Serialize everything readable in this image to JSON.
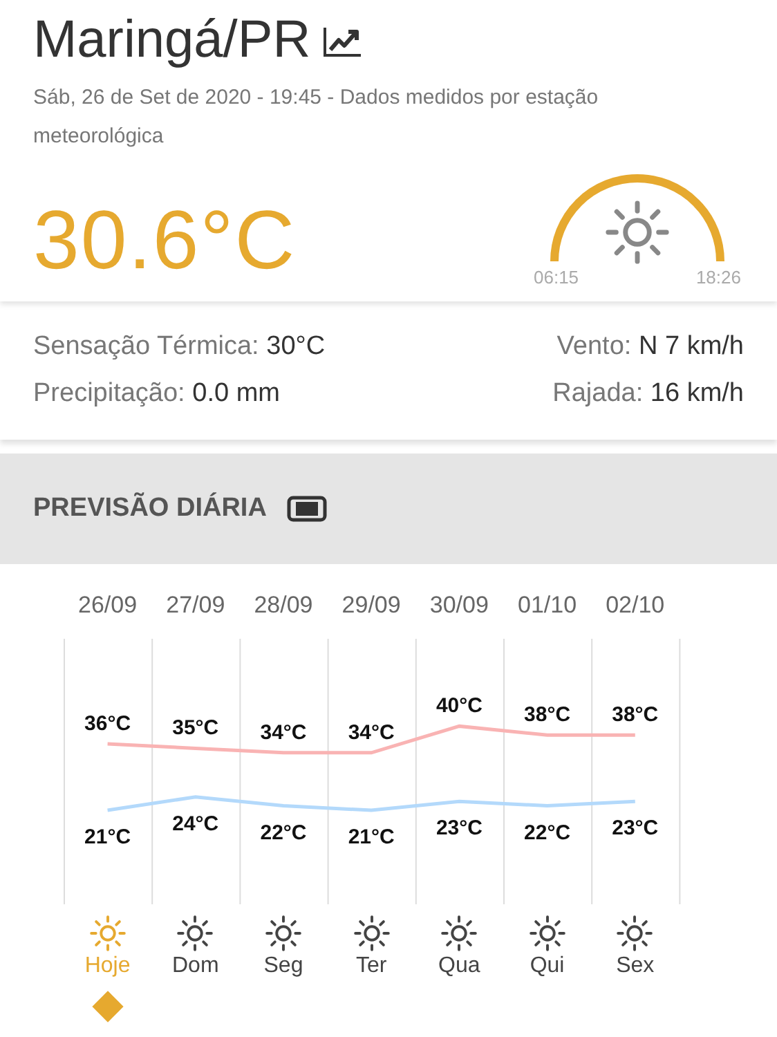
{
  "location": {
    "title": "Maringá/PR",
    "subtitle": "Sáb, 26 de Set de 2020 - 19:45 - Dados medidos por estação meteorológica"
  },
  "current": {
    "temperature": "30.6°C",
    "sunrise": "06:15",
    "sunset": "18:26"
  },
  "details": [
    "Sensação Térmica: **30°C**",
    "Vento: **N 7 km/h**",
    "Precipitação: **0.0 mm**",
    "Rajada: **16 km/h**"
  ],
  "forecast": {
    "title": "PREVISÃO DIÁRIA",
    "chart_data": {
      "type": "line",
      "categories": [
        "26/09",
        "27/09",
        "28/09",
        "29/09",
        "30/09",
        "01/10",
        "02/10"
      ],
      "data_labels": true,
      "series": [
        {
          "color": "#f9b3b3",
          "values": [
            36,
            35,
            34,
            34,
            40,
            38,
            38
          ],
          "value_labels": [
            "36°C",
            "35°C",
            "34°C",
            "34°C",
            "40°C",
            "38°C",
            "38°C"
          ]
        },
        {
          "color": "#b3d9fb",
          "values": [
            21,
            24,
            22,
            21,
            23,
            22,
            23
          ],
          "value_labels": [
            "21°C",
            "24°C",
            "22°C",
            "21°C",
            "23°C",
            "22°C",
            "23°C"
          ]
        }
      ]
    },
    "days": [
      {
        "label": "Hoje",
        "selected": true
      },
      {
        "label": "Dom",
        "selected": false
      },
      {
        "label": "Seg",
        "selected": false
      },
      {
        "label": "Ter",
        "selected": false
      },
      {
        "label": "Qua",
        "selected": false
      },
      {
        "label": "Qui",
        "selected": false
      },
      {
        "label": "Sex",
        "selected": false
      }
    ]
  }
}
